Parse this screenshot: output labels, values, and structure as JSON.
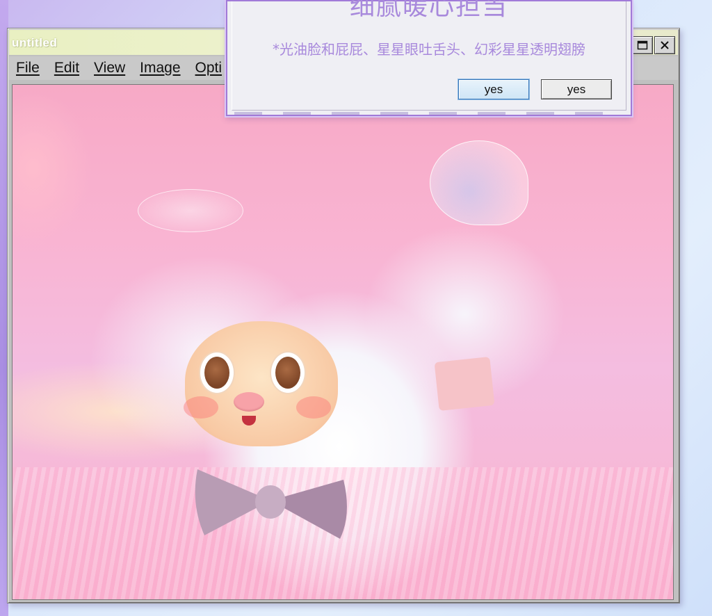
{
  "window": {
    "title": "untitled",
    "controls": {
      "maximize": "maximize-icon",
      "close": "close-icon"
    }
  },
  "menu": {
    "items": [
      "File",
      "Edit",
      "View",
      "Image",
      "Opti"
    ]
  },
  "dialog": {
    "title": "细腻暖心担当",
    "message": "*光油脸和屁屁、星星眼吐舌头、幻彩星星透明翅膀",
    "button_primary": "yes",
    "button_secondary": "yes"
  },
  "colors": {
    "dialog_text": "#a889dc",
    "dialog_border": "#a17ad8",
    "titlebar": "#e9f0c2",
    "window_chrome": "#c0c0c0",
    "canvas_pink": "#f7a9c6"
  }
}
